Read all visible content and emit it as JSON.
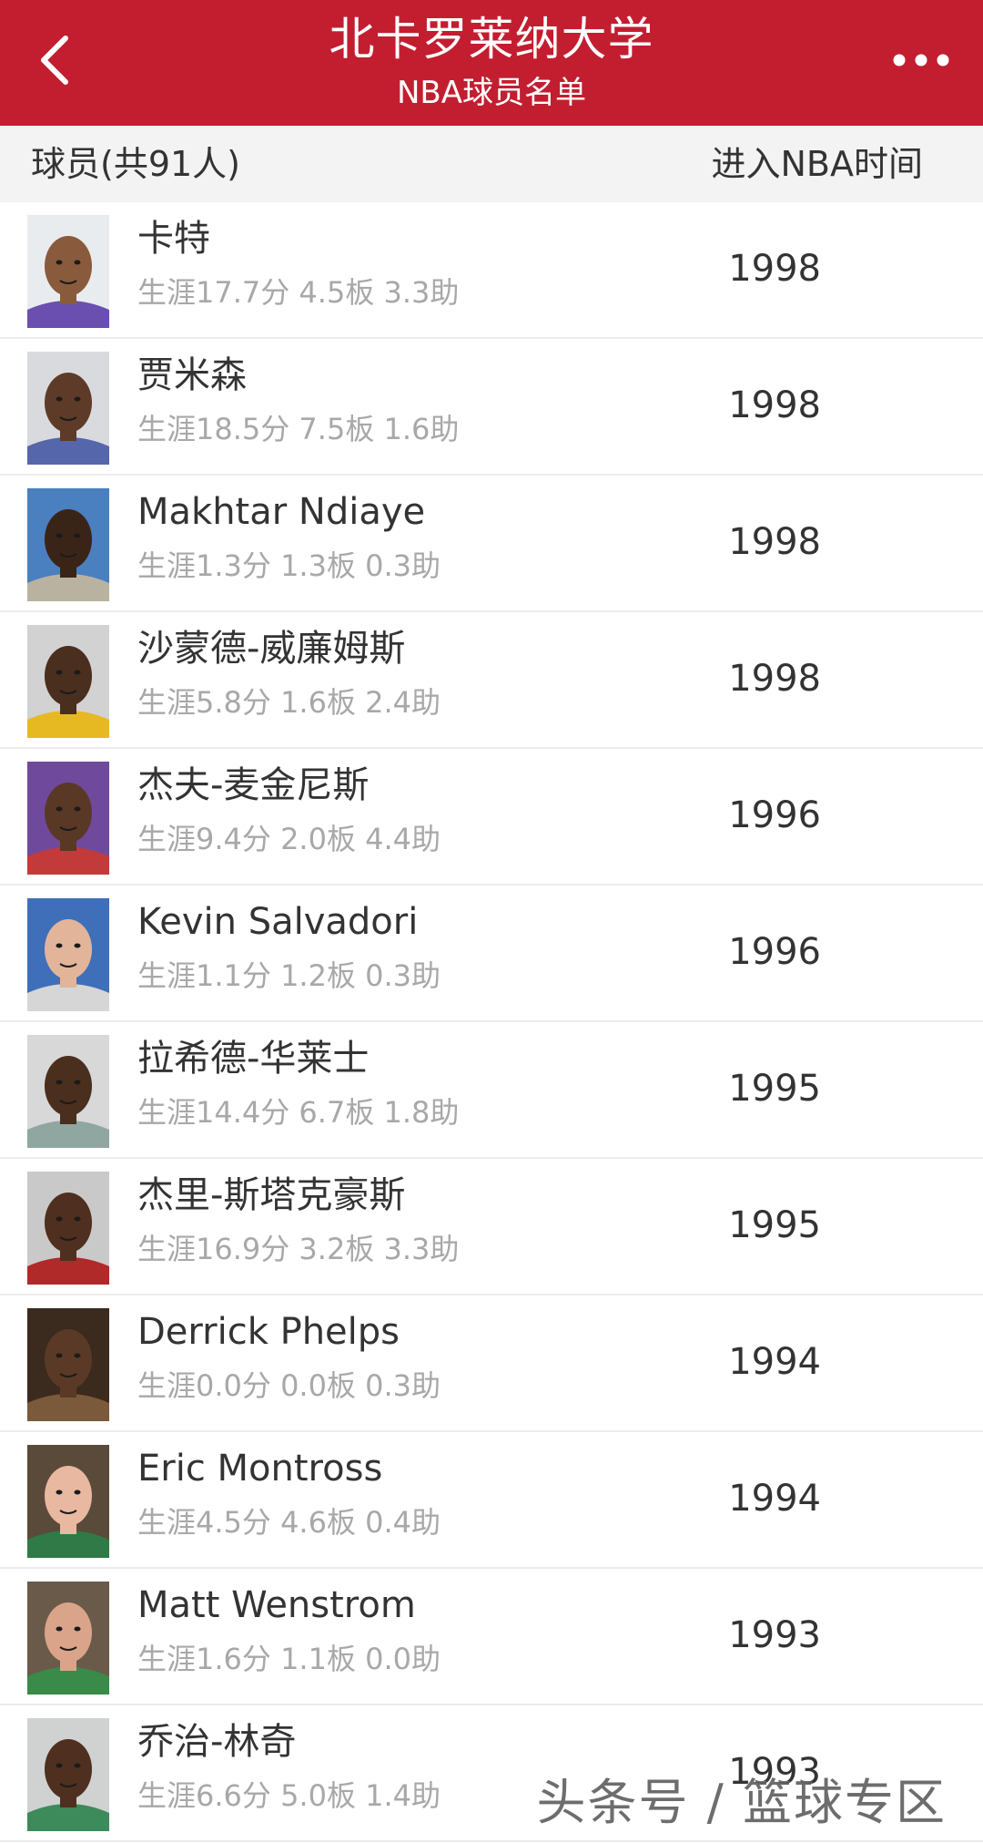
{
  "header": {
    "title": "北卡罗莱纳大学",
    "subtitle": "NBA球员名单",
    "back_icon": "chevron-left-icon",
    "more_icon": "more-dots-icon",
    "background_color": "#c21e30"
  },
  "columns": {
    "left": "球员(共91人)",
    "right": "进入NBA时间"
  },
  "players": [
    {
      "name": "卡特",
      "stats": "生涯17.7分 4.5板 3.3助",
      "year": "1998",
      "jersey_color": "#6a4fb0",
      "skin": "#8a5a3c",
      "bg": "#e9ecef"
    },
    {
      "name": "贾米森",
      "stats": "生涯18.5分 7.5板 1.6助",
      "year": "1998",
      "jersey_color": "#5566aa",
      "skin": "#5e3b28",
      "bg": "#d9dade"
    },
    {
      "name": "Makhtar Ndiaye",
      "stats": "生涯1.3分 1.3板 0.3助",
      "year": "1998",
      "jersey_color": "#b9b2a0",
      "skin": "#3a2418",
      "bg": "#4a7fc0"
    },
    {
      "name": "沙蒙德-威廉姆斯",
      "stats": "生涯5.8分 1.6板 2.4助",
      "year": "1998",
      "jersey_color": "#e6b923",
      "skin": "#4a2e1e",
      "bg": "#d2d2d2"
    },
    {
      "name": "杰夫-麦金尼斯",
      "stats": "生涯9.4分 2.0板 4.4助",
      "year": "1996",
      "jersey_color": "#c23a3a",
      "skin": "#5a3826",
      "bg": "#6f4a9c"
    },
    {
      "name": "Kevin Salvadori",
      "stats": "生涯1.1分 1.2板 0.3助",
      "year": "1996",
      "jersey_color": "#d6d6d6",
      "skin": "#e2b49a",
      "bg": "#3f6fb8"
    },
    {
      "name": "拉希德-华莱士",
      "stats": "生涯14.4分 6.7板 1.8助",
      "year": "1995",
      "jersey_color": "#8fa7a0",
      "skin": "#4a2e1e",
      "bg": "#d8d8d8"
    },
    {
      "name": "杰里-斯塔克豪斯",
      "stats": "生涯16.9分 3.2板 3.3助",
      "year": "1995",
      "jersey_color": "#b02a2a",
      "skin": "#4f2f1f",
      "bg": "#c9c9c9"
    },
    {
      "name": "Derrick Phelps",
      "stats": "生涯0.0分 0.0板 0.3助",
      "year": "1994",
      "jersey_color": "#7a5a3a",
      "skin": "#5a3a26",
      "bg": "#3b2a1e"
    },
    {
      "name": "Eric Montross",
      "stats": "生涯4.5分 4.6板 0.4助",
      "year": "1994",
      "jersey_color": "#2f7a46",
      "skin": "#e8b8a0",
      "bg": "#5a4a3a"
    },
    {
      "name": "Matt Wenstrom",
      "stats": "生涯1.6分 1.1板 0.0助",
      "year": "1993",
      "jersey_color": "#3a8a4a",
      "skin": "#d9a48a",
      "bg": "#6a5a4a"
    },
    {
      "name": "乔治-林奇",
      "stats": "生涯6.6分 5.0板 1.4助",
      "year": "1993",
      "jersey_color": "#3d8a5a",
      "skin": "#4f2f1f",
      "bg": "#cfd2d0"
    }
  ],
  "watermark": "头条号 / 篮球专区"
}
